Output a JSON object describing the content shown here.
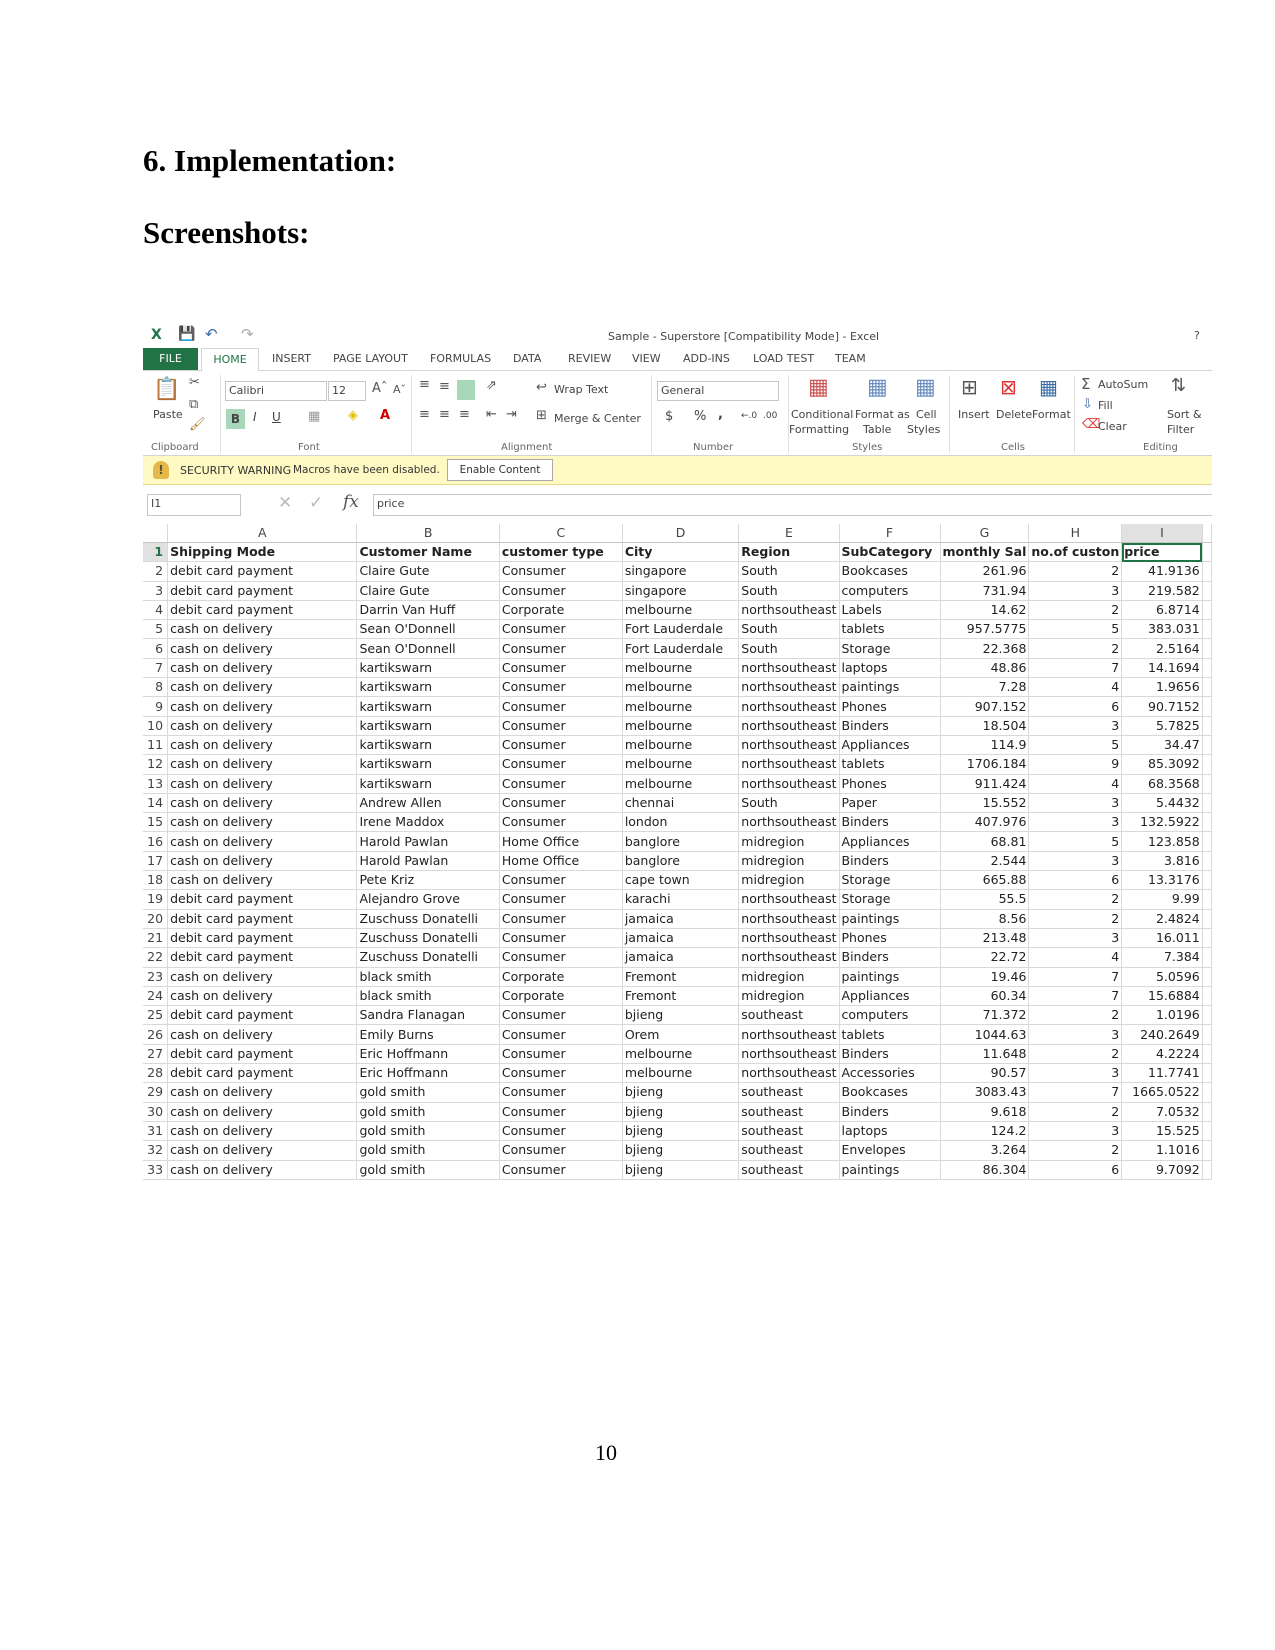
{
  "doc": {
    "heading": "6. Implementation:",
    "subheading": "Screenshots:",
    "page_number": "10"
  },
  "excel": {
    "window_title": "Sample - Superstore  [Compatibility Mode] - Excel",
    "help": "?",
    "tabs": [
      "FILE",
      "HOME",
      "INSERT",
      "PAGE LAYOUT",
      "FORMULAS",
      "DATA",
      "REVIEW",
      "VIEW",
      "ADD-INS",
      "LOAD TEST",
      "TEAM"
    ],
    "ribbon": {
      "paste": "Paste",
      "font_name": "Calibri",
      "font_size": "12",
      "bold": "B",
      "italic": "I",
      "underline": "U",
      "wrap_text": "Wrap Text",
      "merge_center": "Merge & Center",
      "number_format": "General",
      "currency": "$",
      "percent": "%",
      "comma": ",",
      "conditional": "Conditional",
      "formatting": "Formatting",
      "format_as": "Format as",
      "table": "Table",
      "cell": "Cell",
      "styles_btn": "Styles",
      "insert": "Insert",
      "delete": "Delete",
      "format": "Format",
      "autosum": "AutoSum",
      "fill": "Fill",
      "clear": "Clear",
      "sort": "Sort &",
      "filter": "Filter",
      "groups": [
        "Clipboard",
        "Font",
        "Alignment",
        "Number",
        "Styles",
        "Cells",
        "Editing"
      ]
    },
    "security": {
      "label": "SECURITY WARNING",
      "message": "Macros have been disabled.",
      "button": "Enable Content"
    },
    "name_box": "I1",
    "formula": "price",
    "fx": "fx",
    "columns": [
      "A",
      "B",
      "C",
      "D",
      "E",
      "F",
      "G",
      "H",
      "I"
    ],
    "header_row": [
      "Shipping Mode",
      "Customer Name",
      "customer type",
      "City",
      "Region",
      "SubCategory",
      "monthly Sales",
      "no.of customers",
      "price"
    ],
    "header_display": [
      "Shipping Mode",
      "Customer Name",
      "customer type",
      "City",
      "Region",
      "SubCategory",
      "monthly Sal",
      "no.of custon",
      "price"
    ],
    "rows": [
      [
        "debit card payment",
        "Claire Gute",
        "Consumer",
        "singapore",
        "South",
        "Bookcases",
        "261.96",
        "2",
        "41.9136"
      ],
      [
        "debit card payment",
        "Claire Gute",
        "Consumer",
        "singapore",
        "South",
        "computers",
        "731.94",
        "3",
        "219.582"
      ],
      [
        "debit card payment",
        "Darrin Van Huff",
        "Corporate",
        "melbourne",
        "northsoutheast",
        "Labels",
        "14.62",
        "2",
        "6.8714"
      ],
      [
        "cash on delivery",
        "Sean O'Donnell",
        "Consumer",
        "Fort Lauderdale",
        "South",
        "tablets",
        "957.5775",
        "5",
        "383.031"
      ],
      [
        "cash on delivery",
        "Sean O'Donnell",
        "Consumer",
        "Fort Lauderdale",
        "South",
        "Storage",
        "22.368",
        "2",
        "2.5164"
      ],
      [
        "cash on delivery",
        "kartikswarn",
        "Consumer",
        "melbourne",
        "northsoutheast",
        "laptops",
        "48.86",
        "7",
        "14.1694"
      ],
      [
        "cash on delivery",
        "kartikswarn",
        "Consumer",
        "melbourne",
        "northsoutheast",
        "paintings",
        "7.28",
        "4",
        "1.9656"
      ],
      [
        "cash on delivery",
        "kartikswarn",
        "Consumer",
        "melbourne",
        "northsoutheast",
        "Phones",
        "907.152",
        "6",
        "90.7152"
      ],
      [
        "cash on delivery",
        "kartikswarn",
        "Consumer",
        "melbourne",
        "northsoutheast",
        "Binders",
        "18.504",
        "3",
        "5.7825"
      ],
      [
        "cash on delivery",
        "kartikswarn",
        "Consumer",
        "melbourne",
        "northsoutheast",
        "Appliances",
        "114.9",
        "5",
        "34.47"
      ],
      [
        "cash on delivery",
        "kartikswarn",
        "Consumer",
        "melbourne",
        "northsoutheast",
        "tablets",
        "1706.184",
        "9",
        "85.3092"
      ],
      [
        "cash on delivery",
        "kartikswarn",
        "Consumer",
        "melbourne",
        "northsoutheast",
        "Phones",
        "911.424",
        "4",
        "68.3568"
      ],
      [
        "cash on delivery",
        "Andrew Allen",
        "Consumer",
        "chennai",
        "South",
        "Paper",
        "15.552",
        "3",
        "5.4432"
      ],
      [
        "cash on delivery",
        "Irene Maddox",
        "Consumer",
        "london",
        "northsoutheast",
        "Binders",
        "407.976",
        "3",
        "132.5922"
      ],
      [
        "cash on delivery",
        "Harold Pawlan",
        "Home Office",
        "banglore",
        "midregion",
        "Appliances",
        "68.81",
        "5",
        "123.858"
      ],
      [
        "cash on delivery",
        "Harold Pawlan",
        "Home Office",
        "banglore",
        "midregion",
        "Binders",
        "2.544",
        "3",
        "3.816"
      ],
      [
        "cash on delivery",
        "Pete Kriz",
        "Consumer",
        "cape town",
        "midregion",
        "Storage",
        "665.88",
        "6",
        "13.3176"
      ],
      [
        "debit card payment",
        "Alejandro Grove",
        "Consumer",
        "karachi",
        "northsoutheast",
        "Storage",
        "55.5",
        "2",
        "9.99"
      ],
      [
        "debit card payment",
        "Zuschuss Donatelli",
        "Consumer",
        "jamaica",
        "northsoutheast",
        "paintings",
        "8.56",
        "2",
        "2.4824"
      ],
      [
        "debit card payment",
        "Zuschuss Donatelli",
        "Consumer",
        "jamaica",
        "northsoutheast",
        "Phones",
        "213.48",
        "3",
        "16.011"
      ],
      [
        "debit card payment",
        "Zuschuss Donatelli",
        "Consumer",
        "jamaica",
        "northsoutheast",
        "Binders",
        "22.72",
        "4",
        "7.384"
      ],
      [
        "cash on delivery",
        "black smith",
        "Corporate",
        "Fremont",
        "midregion",
        "paintings",
        "19.46",
        "7",
        "5.0596"
      ],
      [
        "cash on delivery",
        "black smith",
        "Corporate",
        "Fremont",
        "midregion",
        "Appliances",
        "60.34",
        "7",
        "15.6884"
      ],
      [
        "debit card payment",
        "Sandra Flanagan",
        "Consumer",
        "bjieng",
        "southeast",
        "computers",
        "71.372",
        "2",
        "1.0196"
      ],
      [
        "cash on delivery",
        "Emily Burns",
        "Consumer",
        "Orem",
        "northsoutheast",
        "tablets",
        "1044.63",
        "3",
        "240.2649"
      ],
      [
        "debit card payment",
        "Eric Hoffmann",
        "Consumer",
        "melbourne",
        "northsoutheast",
        "Binders",
        "11.648",
        "2",
        "4.2224"
      ],
      [
        "debit card payment",
        "Eric Hoffmann",
        "Consumer",
        "melbourne",
        "northsoutheast",
        "Accessories",
        "90.57",
        "3",
        "11.7741"
      ],
      [
        "cash on delivery",
        "gold smith",
        "Consumer",
        "bjieng",
        "southeast",
        "Bookcases",
        "3083.43",
        "7",
        "1665.0522"
      ],
      [
        "cash on delivery",
        "gold smith",
        "Consumer",
        "bjieng",
        "southeast",
        "Binders",
        "9.618",
        "2",
        "7.0532"
      ],
      [
        "cash on delivery",
        "gold smith",
        "Consumer",
        "bjieng",
        "southeast",
        "laptops",
        "124.2",
        "3",
        "15.525"
      ],
      [
        "cash on delivery",
        "gold smith",
        "Consumer",
        "bjieng",
        "southeast",
        "Envelopes",
        "3.264",
        "2",
        "1.1016"
      ],
      [
        "cash on delivery",
        "gold smith",
        "Consumer",
        "bjieng",
        "southeast",
        "paintings",
        "86.304",
        "6",
        "9.7092"
      ]
    ],
    "colors": {
      "accent": "#217346",
      "warning_bg": "#fff9c4"
    }
  }
}
